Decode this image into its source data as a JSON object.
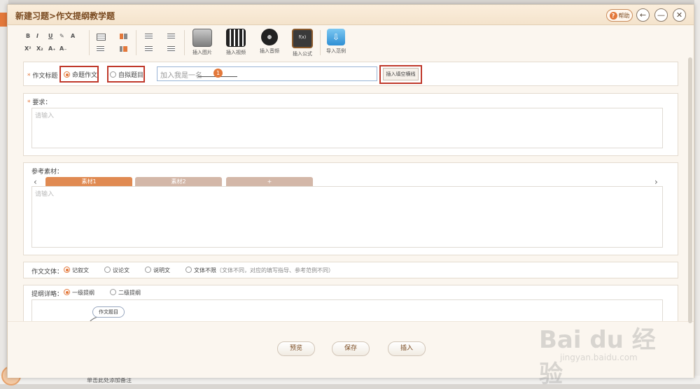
{
  "window": {
    "title": "新建习题>作文提纲教学题",
    "help_label": "帮助"
  },
  "toolbar": {
    "format_row1": [
      "B",
      "I",
      "U",
      "A"
    ],
    "format_row2": [
      "X²",
      "X₂",
      "A₊",
      "A₋"
    ],
    "big_buttons": [
      {
        "label": "插入图片",
        "icon": "image-icon"
      },
      {
        "label": "插入视频",
        "icon": "video-icon"
      },
      {
        "label": "插入音频",
        "icon": "audio-icon"
      },
      {
        "label": "插入公式",
        "icon": "formula-icon"
      },
      {
        "label": "导入范例",
        "icon": "import-icon"
      }
    ]
  },
  "title_row": {
    "label": "作文标题",
    "option1": "命题作文",
    "option2": "自拟题目",
    "input_value": "加入我是一名",
    "badge": "1",
    "insert_blank_button": "插入填空横线"
  },
  "requirements": {
    "label": "要求：",
    "placeholder": "请输入"
  },
  "materials": {
    "label": "参考素材：",
    "tabs": [
      "素材1",
      "素材2",
      "+"
    ],
    "placeholder": "请输入"
  },
  "genre": {
    "label": "作文文体：",
    "options": [
      "记叙文",
      "议论文",
      "说明文",
      "文体不限"
    ],
    "note": "（文体不同，对应的填写指导、参考范例不同）"
  },
  "outline": {
    "label": "提纲详略：",
    "options": [
      "一级提纲",
      "二级提纲"
    ],
    "node": "作文题目"
  },
  "footer": {
    "preview": "预览",
    "save": "保存",
    "insert": "插入"
  },
  "bottom_bar": {
    "note": "单击此处添加备注"
  },
  "watermark": {
    "brand": "Bai du 经验",
    "url": "jingyan.baidu.com"
  }
}
